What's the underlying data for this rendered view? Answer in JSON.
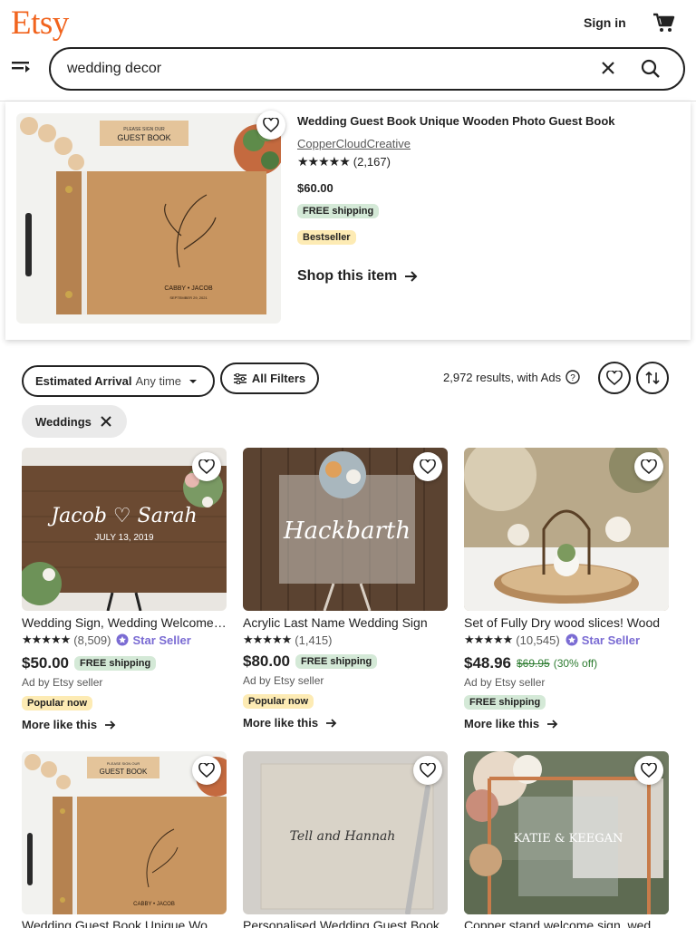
{
  "header": {
    "logo": "Etsy",
    "sign_in": "Sign in",
    "search_value": "wedding decor",
    "brand_color": "#F1641E"
  },
  "featured": {
    "title": "Wedding Guest Book Unique Wooden Photo Guest Book",
    "shop": "CopperCloudCreative",
    "rating_count": "(2,167)",
    "price": "$60.00",
    "shipping_badge": "FREE shipping",
    "bestseller_badge": "Bestseller",
    "shop_link": "Shop this item",
    "image_text_top": "PLEASE SIGN OUR",
    "image_text_main": "GUEST BOOK",
    "image_names": "CABBY • JACOB",
    "image_date": "SEPTEMBER 29, 2021"
  },
  "filters": {
    "arrival_label": "Estimated Arrival",
    "arrival_value": "Any time",
    "all_filters": "All Filters",
    "results": "2,972 results, with Ads",
    "active_chip": "Weddings"
  },
  "listings": [
    {
      "title": "Wedding Sign, Wedding Welcome Sign",
      "rating_count": "(8,509)",
      "star_seller": "Star Seller",
      "price": "$50.00",
      "shipping": "FREE shipping",
      "ad": "Ad by Etsy seller",
      "badge": "Popular now",
      "more": "More like this",
      "img_names": "Jacob ♡ Sarah",
      "img_date": "JULY 13, 2019"
    },
    {
      "title": "Acrylic Last Name Wedding Sign",
      "rating_count": "(1,415)",
      "price": "$80.00",
      "shipping": "FREE shipping",
      "ad": "Ad by Etsy seller",
      "badge": "Popular now",
      "more": "More like this",
      "img_name": "Hackbarth"
    },
    {
      "title": "Set of Fully Dry wood slices! Wood",
      "rating_count": "(10,545)",
      "star_seller": "Star Seller",
      "price": "$48.96",
      "original_price": "$69.95",
      "discount": "(30% off)",
      "ad": "Ad by Etsy seller",
      "badge": "FREE shipping",
      "more": "More like this"
    },
    {
      "title": "Wedding Guest Book Unique Wooden",
      "img_top": "PLEASE SIGN OUR",
      "img_main": "GUEST BOOK",
      "img_names": "CABBY • JACOB"
    },
    {
      "title": "Personalised Wedding Guest Book",
      "img_script": "Tell and Hannah"
    },
    {
      "title": "Copper stand welcome sign, wedding",
      "img_names": "KATIE & KEEGAN"
    }
  ]
}
